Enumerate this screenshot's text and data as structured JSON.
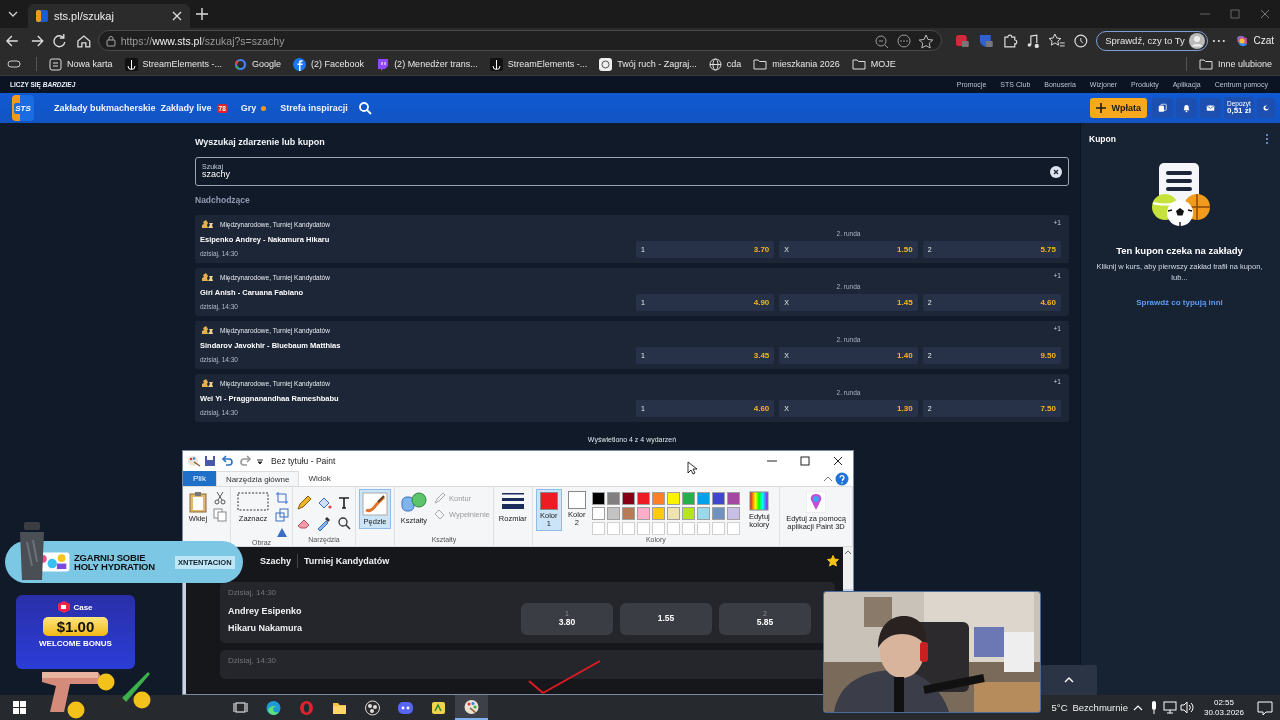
{
  "browser": {
    "tab_title": "sts.pl/szukaj",
    "url": {
      "scheme": "https://",
      "host": "www.sts.pl",
      "path": "/szukaj?s=szachy"
    },
    "profile_button": "Sprawdź, czy to Ty",
    "chat_button": "Czat",
    "bookmarks": [
      {
        "label": "Nowa karta",
        "kind": "tab"
      },
      {
        "label": "StreamElements -...",
        "kind": "anchor"
      },
      {
        "label": "Google",
        "kind": "ring"
      },
      {
        "label": "(2) Facebook",
        "kind": "blue"
      },
      {
        "label": "(2) Menedżer trans...",
        "kind": "bubble"
      },
      {
        "label": "StreamElements -...",
        "kind": "anchor"
      },
      {
        "label": "Twój ruch - Zagraj...",
        "kind": "badge"
      },
      {
        "label": "cda",
        "kind": "globe"
      },
      {
        "label": "mieszkania 2026",
        "kind": "folder"
      },
      {
        "label": "MOJE",
        "kind": "folder"
      }
    ],
    "other_bookmarks": "Inne ulubione"
  },
  "site": {
    "tagline": "LICZY SIĘ *BARDZIEJ*",
    "top_links": [
      "Promocje",
      "STS Club",
      "Bonuseria",
      "Wizjoner",
      "Produkty",
      "Aplikacja",
      "Centrum pomocy"
    ],
    "logo": "STS",
    "nav": [
      {
        "label": "Zakłady bukmacherskie"
      },
      {
        "label": "Zakłady live",
        "badge": "78"
      },
      {
        "label": "Gry",
        "dot": true
      },
      {
        "label": "Strefa inspiracji"
      }
    ],
    "deposit_button": "Wpłata",
    "balance": {
      "label": "Depozyt",
      "value": "0,51 zł"
    }
  },
  "search": {
    "heading": "Wyszukaj zdarzenie lub kupon",
    "label": "Szukaj",
    "value": "szachy"
  },
  "section_title": "Nadchodzące",
  "events": [
    {
      "league": "Międzynarodowe, Turniej Kandydatów",
      "match": "Esipenko Andrey - Nakamura Hikaru",
      "time": "dzisiaj, 14:30",
      "round": "2. runda",
      "more": "+1",
      "odds": [
        {
          "label": "1",
          "value": "3.70"
        },
        {
          "label": "X",
          "value": "1.50"
        },
        {
          "label": "2",
          "value": "5.75"
        }
      ]
    },
    {
      "league": "Międzynarodowe, Turniej Kandydatów",
      "match": "Giri Anish - Caruana Fabiano",
      "time": "dzisiaj, 14:30",
      "round": "2. runda",
      "more": "+1",
      "odds": [
        {
          "label": "1",
          "value": "4.90"
        },
        {
          "label": "X",
          "value": "1.45"
        },
        {
          "label": "2",
          "value": "4.60"
        }
      ]
    },
    {
      "league": "Międzynarodowe, Turniej Kandydatów",
      "match": "Sindarov Javokhir - Bluebaum Matthias",
      "time": "dzisiaj, 14:30",
      "round": "2. runda",
      "more": "+1",
      "odds": [
        {
          "label": "1",
          "value": "3.45"
        },
        {
          "label": "X",
          "value": "1.40"
        },
        {
          "label": "2",
          "value": "9.50"
        }
      ]
    },
    {
      "league": "Międzynarodowe, Turniej Kandydatów",
      "match": "Wei Yi - Praggnanandhaa Rameshbabu",
      "time": "dzisiaj, 14:30",
      "round": "2. runda",
      "more": "+1",
      "odds": [
        {
          "label": "1",
          "value": "4.60"
        },
        {
          "label": "X",
          "value": "1.30"
        },
        {
          "label": "2",
          "value": "7.50"
        }
      ]
    }
  ],
  "results_count": "Wyświetlono 4 z 4 wydarzeń",
  "coupon": {
    "title": "Kupon",
    "heading": "Ten kupon czeka na zakłady",
    "text": "Kliknij w kurs, aby pierwszy zakład trafił na kupon, lub...",
    "link": "Sprawdź co typują inni"
  },
  "paint": {
    "title": "Bez tytułu - Paint",
    "tabs": [
      {
        "label": "Plik",
        "kind": "file",
        "selected": false
      },
      {
        "label": "Narzędzia główne",
        "kind": "tab",
        "selected": true
      },
      {
        "label": "Widok",
        "kind": "tab",
        "selected": false
      }
    ],
    "ribbon": {
      "paste": "Wklej",
      "select": "Zaznacz",
      "image_group": "Obraz",
      "tools_group": "Narzędzia",
      "brushes": {
        "label": "Pędzle",
        "selected": true
      },
      "shapes": "Kształty",
      "outline": "Kontur",
      "fill": "Wypełnienie",
      "shapes_group": "Kształty",
      "size": "Rozmiar",
      "colors_group": "Kolory",
      "edit_colors": "Edytuj kolory",
      "paint3d": "Edytuj za pomocą aplikacji Paint 3D"
    },
    "color_slots": [
      {
        "label": "Kolor 1",
        "color": "#ed1c24",
        "selected": true
      },
      {
        "label": "Kolor 2",
        "color": "#ffffff",
        "selected": false
      }
    ],
    "palette": [
      {
        "color": "#000000"
      },
      {
        "color": "#7f7f7f"
      },
      {
        "color": "#880015"
      },
      {
        "color": "#ed1c24"
      },
      {
        "color": "#ff7f27"
      },
      {
        "color": "#fff200"
      },
      {
        "color": "#22b14c"
      },
      {
        "color": "#00a2e8"
      },
      {
        "color": "#3f48cc"
      },
      {
        "color": "#a349a4"
      },
      {
        "color": "#ffffff"
      },
      {
        "color": "#c3c3c3"
      },
      {
        "color": "#b97a57"
      },
      {
        "color": "#ffaec9"
      },
      {
        "color": "#ffc90e"
      },
      {
        "color": "#efe4b0"
      },
      {
        "color": "#b5e61d"
      },
      {
        "color": "#99d9ea"
      },
      {
        "color": "#7092be"
      },
      {
        "color": "#c8bfe7"
      }
    ],
    "canvas": {
      "breadcrumb": [
        "Szachy",
        "Turniej Kandydatów"
      ],
      "favorite": true,
      "events": [
        {
          "time": "Dzisiaj, 14:30",
          "players": [
            "Andrey Esipenko",
            "Hikaru Nakamura"
          ],
          "odds": [
            {
              "label": "1",
              "value": "3.80"
            },
            {
              "value": "1.55"
            },
            {
              "label": "2",
              "value": "5.85"
            }
          ]
        },
        {
          "time": "Dzisiaj, 14:30"
        }
      ]
    }
  },
  "overlays": {
    "drink_ad": {
      "headline": "ZGARNIJ SOBIE HOLY HYDRATION",
      "tag": "XNTENTACION"
    },
    "bonus_ad": {
      "brand": "Case",
      "amount": "$1.00",
      "caption": "WELCOME BONUS"
    }
  },
  "taskbar": {
    "apps": [
      {
        "kind": "taskview",
        "selected": false
      },
      {
        "kind": "edge",
        "selected": false
      },
      {
        "kind": "opera",
        "selected": false
      },
      {
        "kind": "folder",
        "selected": false
      },
      {
        "kind": "obs",
        "selected": false
      },
      {
        "kind": "discord",
        "selected": false
      },
      {
        "kind": "app",
        "selected": false
      },
      {
        "kind": "paint",
        "selected": true
      }
    ],
    "weather": {
      "temp": "5°C",
      "condition": "Bezchmurnie"
    },
    "time": "02:55",
    "date": "30.03.2026"
  }
}
